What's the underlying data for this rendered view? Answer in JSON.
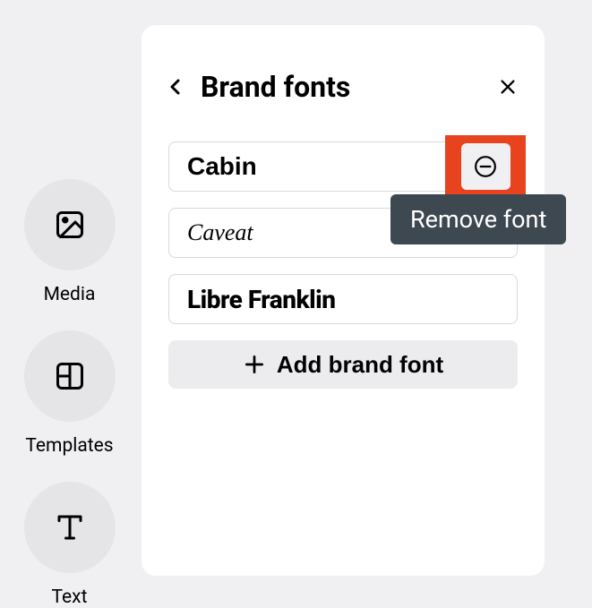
{
  "sidebar": {
    "items": [
      {
        "label": "Media"
      },
      {
        "label": "Templates"
      },
      {
        "label": "Text"
      }
    ]
  },
  "panel": {
    "title": "Brand fonts",
    "fonts": [
      {
        "name": "Cabin"
      },
      {
        "name": "Caveat"
      },
      {
        "name": "Libre Franklin"
      }
    ],
    "add_button_label": "Add brand font"
  },
  "tooltip": {
    "text": "Remove font"
  }
}
